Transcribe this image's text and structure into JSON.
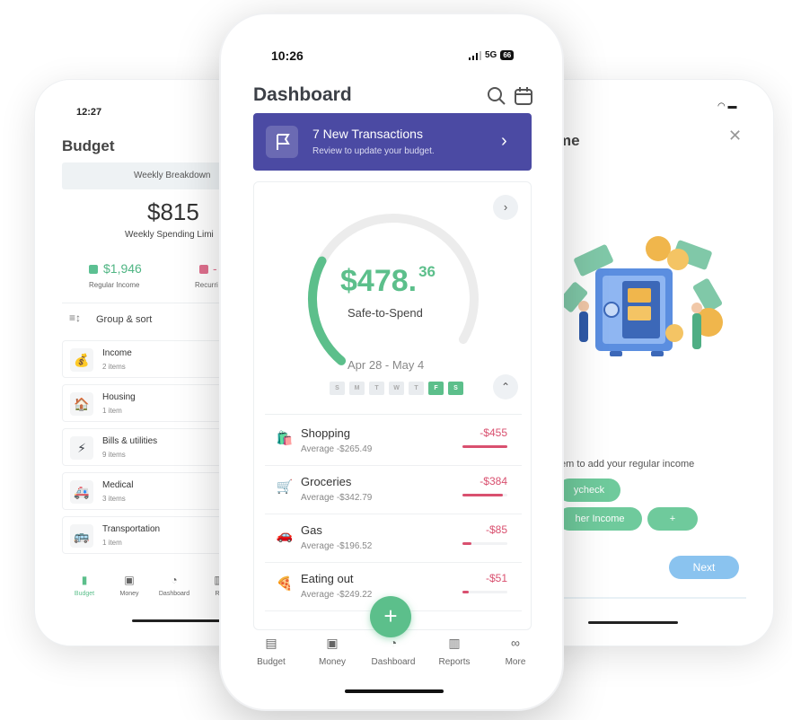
{
  "left_phone": {
    "time": "12:27",
    "title": "Budget",
    "weekly_header": "Weekly Breakdown",
    "amount": "$815",
    "limit_label": "Weekly Spending Limi",
    "income_value": "$1,946",
    "income_label": "Regular Income",
    "recurring_value": "-",
    "recurring_label": "Recurri",
    "sort_label": "Group & sort",
    "categories": [
      {
        "name": "Income",
        "sub": "2 items",
        "icon": "money-bag-icon",
        "glyph": "💰"
      },
      {
        "name": "Housing",
        "sub": "1 item",
        "icon": "house-icon",
        "glyph": "🏠"
      },
      {
        "name": "Bills & utilities",
        "sub": "9 items",
        "icon": "lightning-icon",
        "glyph": "⚡"
      },
      {
        "name": "Medical",
        "sub": "3 items",
        "icon": "ambulance-icon",
        "glyph": "🚑"
      },
      {
        "name": "Transportation",
        "sub": "1 item",
        "icon": "bus-icon",
        "glyph": "🚌"
      }
    ],
    "tabs": [
      "Budget",
      "Money",
      "Dashboard",
      "Re"
    ]
  },
  "right_phone": {
    "title": "me",
    "instruction": "tem to add your regular income",
    "pill_paycheck": "ycheck",
    "pill_other": "her Income",
    "pill_add": "+",
    "next_label": "Next"
  },
  "center_phone": {
    "time": "10:26",
    "network": "5G",
    "battery": "66",
    "title": "Dashboard",
    "banner": {
      "title": "7 New Transactions",
      "subtitle": "Review to update your budget."
    },
    "safe_amount_main": "$478.",
    "safe_amount_cents": "36",
    "safe_label": "Safe-to-Spend",
    "safe_progress": 0.3,
    "date_range": "Apr 28 - May 4",
    "days": [
      {
        "label": "S",
        "active": false
      },
      {
        "label": "M",
        "active": false
      },
      {
        "label": "T",
        "active": false
      },
      {
        "label": "W",
        "active": false
      },
      {
        "label": "T",
        "active": false
      },
      {
        "label": "F",
        "active": true
      },
      {
        "label": "S",
        "active": true
      }
    ],
    "rows": [
      {
        "name": "Shopping",
        "average": "Average -$265.49",
        "amount": "-$455",
        "fill": 1.0,
        "glyph": "🛍️",
        "icon": "shopping-bag-icon"
      },
      {
        "name": "Groceries",
        "average": "Average -$342.79",
        "amount": "-$384",
        "fill": 0.9,
        "glyph": "🛒",
        "icon": "cart-icon"
      },
      {
        "name": "Gas",
        "average": "Average -$196.52",
        "amount": "-$85",
        "fill": 0.2,
        "glyph": "🚗",
        "icon": "car-icon"
      },
      {
        "name": "Eating out",
        "average": "Average -$249.22",
        "amount": "-$51",
        "fill": 0.14,
        "glyph": "🍕",
        "icon": "pizza-icon"
      }
    ],
    "fab_label": "+",
    "tabs": [
      {
        "label": "Budget",
        "glyph": "▤",
        "icon": "budget-icon"
      },
      {
        "label": "Money",
        "glyph": "▣",
        "icon": "money-icon"
      },
      {
        "label": "Dashboard",
        "glyph": "◔",
        "icon": "dashboard-icon"
      },
      {
        "label": "Reports",
        "glyph": "▥",
        "icon": "reports-icon"
      },
      {
        "label": "More",
        "glyph": "∞",
        "icon": "more-icon"
      }
    ]
  },
  "colors": {
    "accent_green": "#5cbf8b",
    "banner_purple": "#4b4aa3",
    "negative_red": "#d9506f",
    "next_blue": "#8ac3ef"
  }
}
